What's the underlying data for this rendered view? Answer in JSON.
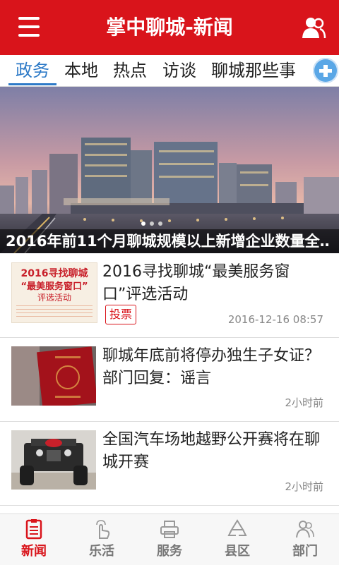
{
  "header": {
    "title": "掌中聊城-新闻",
    "menu_icon": "menu-icon",
    "user_icon": "user-icon"
  },
  "tabs": [
    {
      "label": "政务",
      "active": true
    },
    {
      "label": "本地",
      "active": false
    },
    {
      "label": "热点",
      "active": false
    },
    {
      "label": "访谈",
      "active": false
    },
    {
      "label": "聊城那些事",
      "active": false
    }
  ],
  "banner": {
    "caption": "2016年前11个月聊城规模以上新增企业数量全…"
  },
  "news": [
    {
      "title": "2016寻找聊城“最美服务窗口”评选活动",
      "time": "2016-12-16 08:57",
      "tag": "投票",
      "thumb_lines": [
        "2016寻找聊城",
        "“最美服务窗口”",
        "评选活动"
      ]
    },
    {
      "title": "聊城年底前将停办独生子女证？部门回复：谣言",
      "time": "2小时前"
    },
    {
      "title": "全国汽车场地越野公开赛将在聊城开赛",
      "time": "2小时前"
    }
  ],
  "bottom_nav": [
    {
      "label": "新闻",
      "icon": "news-icon",
      "active": true
    },
    {
      "label": "乐活",
      "icon": "tap-icon",
      "active": false
    },
    {
      "label": "服务",
      "icon": "printer-icon",
      "active": false
    },
    {
      "label": "县区",
      "icon": "recycle-icon",
      "active": false
    },
    {
      "label": "部门",
      "icon": "people-icon",
      "active": false
    }
  ],
  "colors": {
    "brand_red": "#d9141b",
    "tab_blue": "#2d7ac7"
  }
}
